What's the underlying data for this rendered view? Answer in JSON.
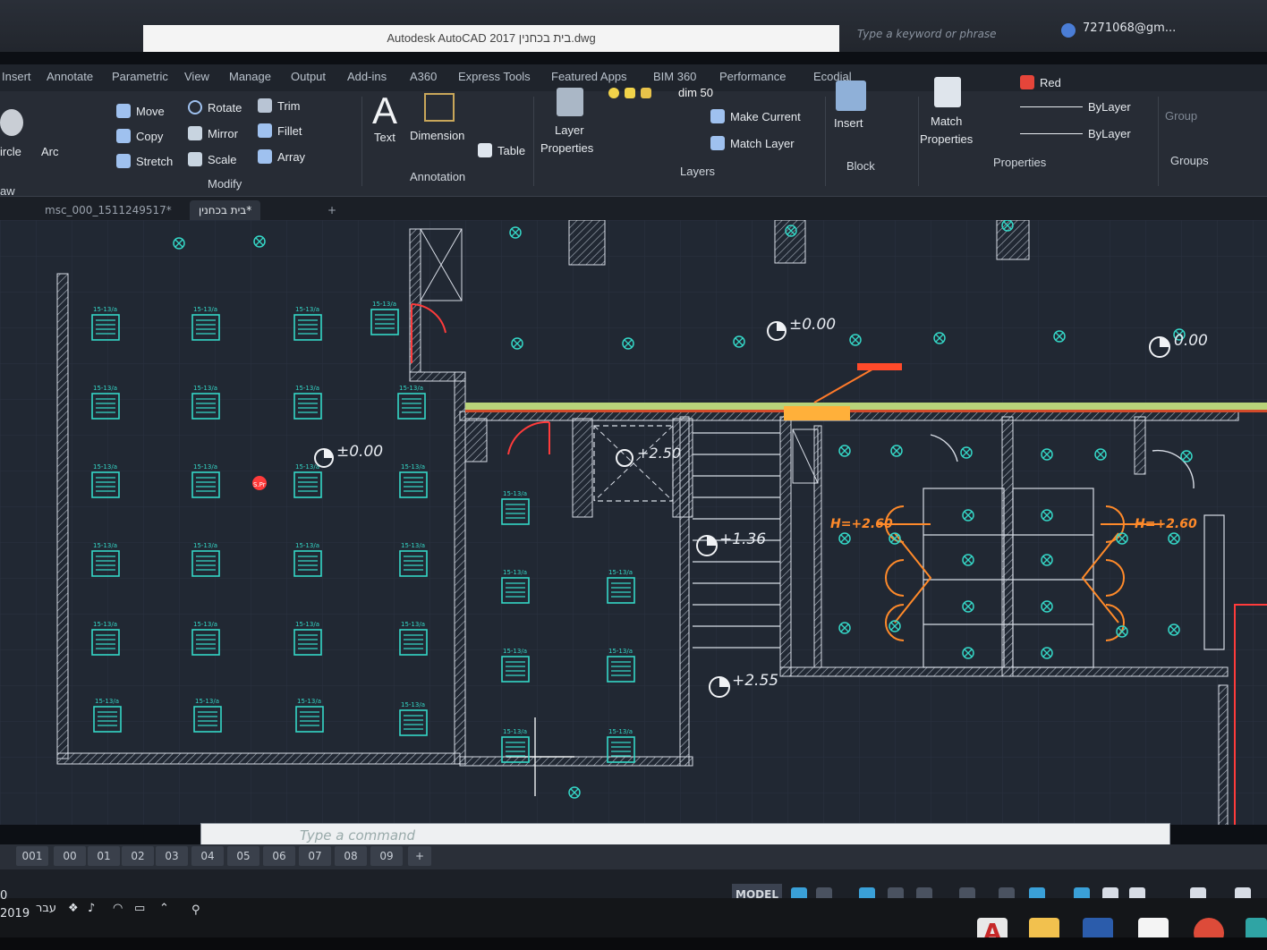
{
  "window": {
    "title": "Autodesk AutoCAD 2017   בית בכחנין.dwg",
    "search_placeholder": "Type a keyword or phrase",
    "user": "7271068@gm..."
  },
  "ribbon_tabs": [
    "Insert",
    "Annotate",
    "Parametric",
    "View",
    "Manage",
    "Output",
    "Add-ins",
    "A360",
    "Express Tools",
    "Featured Apps",
    "BIM 360",
    "Performance",
    "Ecodial"
  ],
  "ribbon": {
    "draw": {
      "circle": "ircle",
      "arc": "Arc",
      "panel": "aw"
    },
    "modify": {
      "move": "Move",
      "rotate": "Rotate",
      "trim": "Trim",
      "copy": "Copy",
      "mirror": "Mirror",
      "fillet": "Fillet",
      "stretch": "Stretch",
      "scale": "Scale",
      "array": "Array",
      "panel": "Modify"
    },
    "annotation": {
      "text": "Text",
      "dimension": "Dimension",
      "table": "Table",
      "panel": "Annotation"
    },
    "layers": {
      "layer_properties_1": "Layer",
      "layer_properties_2": "Properties",
      "current_layer": "dim 50",
      "make_current": "Make Current",
      "match_layer": "Match Layer",
      "panel": "Layers"
    },
    "block": {
      "insert": "Insert",
      "panel": "Block"
    },
    "properties": {
      "match_1": "Match",
      "match_2": "Properties",
      "color": "Red",
      "linetype": "ByLayer",
      "lineweight": "ByLayer",
      "panel": "Properties"
    },
    "groups": {
      "group": "Group",
      "panel": "Groups"
    }
  },
  "file_tabs": {
    "tab1": "msc_000_1511249517*",
    "tab2": "בית בכחנין*",
    "add": "+"
  },
  "drawing": {
    "elevations": [
      "±0.00",
      "±0.00",
      "±0.00",
      "+2.50",
      "+1.36",
      "+2.55",
      "0.00"
    ],
    "heights": [
      "H=+2.60",
      "H=+2.60"
    ],
    "fixture_label": "15-13/a",
    "sp_label": "S.Pr"
  },
  "command_line": {
    "placeholder": "Type a command"
  },
  "layout_tabs": [
    "001",
    "00",
    "01",
    "02",
    "03",
    "04",
    "05",
    "06",
    "07",
    "08",
    "09"
  ],
  "status": {
    "model": "MODEL"
  },
  "taskbar": {
    "lang": "עבר",
    "date_partial": "2019",
    "time_partial": "0"
  },
  "colors": {
    "background": "#212833",
    "fixture": "#35d7c7",
    "wall": "#d8dde6",
    "accent_red": "#ff3b3b",
    "accent_orange": "#ff8a2a",
    "yellow": "#f5e24a"
  }
}
